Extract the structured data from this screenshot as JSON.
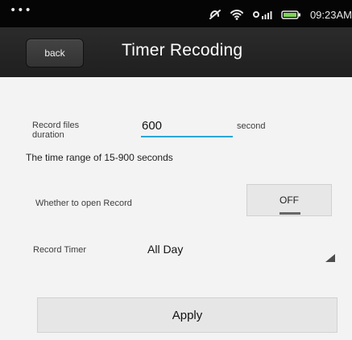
{
  "status_bar": {
    "dots": "•••",
    "time": "09:23AM",
    "icons": [
      "muted-notifications-icon",
      "wifi-icon",
      "cellular-signal-icon",
      "battery-icon"
    ]
  },
  "header": {
    "back_label": "back",
    "title": "Timer Recoding"
  },
  "form": {
    "duration_label": "Record files duration",
    "duration_value": "600",
    "duration_unit": "second",
    "range_note": "The time range of 15-900 seconds",
    "open_record_label": "Whether to open Record",
    "open_record_value": "OFF",
    "record_timer_label": "Record Timer",
    "record_timer_value": "All Day",
    "apply_label": "Apply"
  },
  "colors": {
    "status_bar_bg": "#050505",
    "title_bar_bg": "#2b2b2b",
    "content_bg": "#f3f3f3",
    "input_accent": "#2aa6d7",
    "button_bg": "#e6e6e6",
    "battery_green": "#7fd25a"
  }
}
